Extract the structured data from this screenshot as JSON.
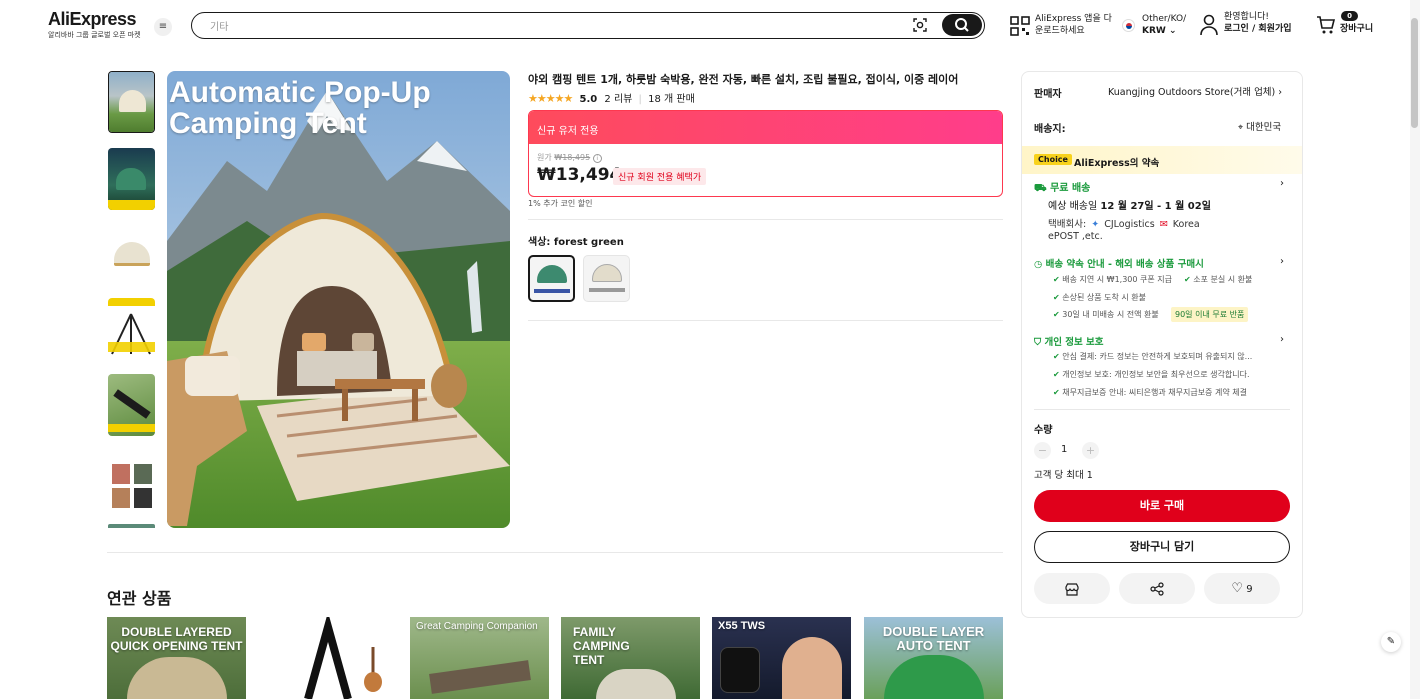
{
  "header": {
    "logo": "AliExpress",
    "logo_sub": "알리바바 그룹 글로벌 오픈 마켓",
    "search_placeholder": "기타",
    "app_line1": "AliExpress 앱을 다",
    "app_line2": "운로드하세요",
    "locale_line1": "Other/KO/",
    "locale_line2": "KRW",
    "greet_line1": "환영합니다!",
    "greet_line2": "로그인 / 회원가입",
    "cart_count": "0",
    "cart_label": "장바구니"
  },
  "product": {
    "title": "야외 캠핑 텐트 1개, 하룻밤 숙박용, 완전 자동, 빠른 설치, 조립 불필요, 접이식, 이중 레이어",
    "score": "5.0",
    "reviews": "2 리뷰",
    "sold": "18 개 판매",
    "promo_label": "신규 유저 전용",
    "orig_label": "원가",
    "orig_price": "₩18,495",
    "price": "₩13,494",
    "price_badge": "신규 회원 전용 혜택가",
    "coin_note": "1% 추가 코인 할인",
    "color_label": "색상:",
    "color_value": "forest green",
    "hero_text": "Automatic Pop-Up Camping Tent"
  },
  "panel": {
    "seller_label": "판매자",
    "seller_value": "Kuangjing Outdoors Store(거래 업체)",
    "ship_to_label": "배송지:",
    "ship_to_value": "대한민국",
    "choice_badge": "Choice",
    "choice_text": "AliExpress의 약속",
    "free_ship": "무료 배송",
    "eta_prefix": "예상 배송일",
    "eta_value": "12 월 27일 - 1 월 02일",
    "carrier_label": "택배회사:",
    "carrier1": "CJLogistics",
    "carrier2": "Korea",
    "carrier3": "ePOST ,etc.",
    "promise_title": "배송 약속 안내 - 해외 배송 상품 구매시",
    "promise1": "배송 지연 시 ₩1,300 쿠폰 지급",
    "promise2": "소포 분실 시 환불",
    "promise3": "손상된 상품 도착 시 환불",
    "promise4": "30일 내 미배송 시 전액 환불",
    "promise4_badge": "90일 이내 무료 반품",
    "privacy_title": "개인 정보 보호",
    "privacy1": "안심 결제: 카드 정보는 안전하게 보호되며 유출되지 않...",
    "privacy2": "개인정보 보호: 개인정보 보안을 최우선으로 생각합니다.",
    "privacy3": "채무지급보증 안내: 씨티은행과 채무지급보증 계약 체결",
    "qty_label": "수량",
    "qty_value": "1",
    "qty_limit": "고객 당 최대 1",
    "buy_now": "바로 구매",
    "add_cart": "장바구니 담기",
    "wish_count": "9"
  },
  "related": {
    "title": "연관 상품",
    "items": [
      {
        "caption": "DOUBLE LAYERED QUICK OPENING TENT"
      },
      {
        "caption": ""
      },
      {
        "caption": "Great Camping Companion"
      },
      {
        "caption": "FAMILY CAMPING TENT"
      },
      {
        "caption": "X55 TWS"
      },
      {
        "caption": "DOUBLE LAYER AUTO TENT"
      }
    ]
  },
  "colors": {
    "accent_red": "#e0001b",
    "promo_pink": "#fe4b5c",
    "success_green": "#1a9a3c",
    "choice_yellow": "#fff7d6"
  }
}
